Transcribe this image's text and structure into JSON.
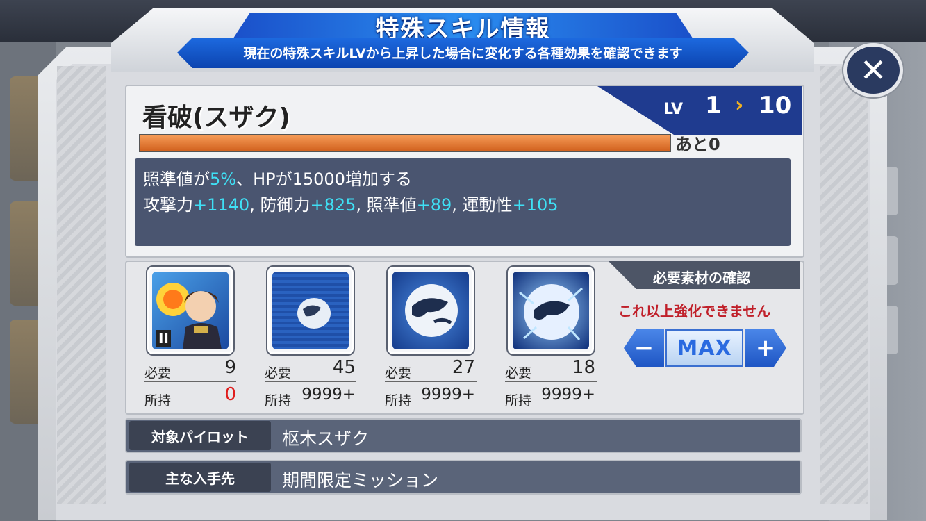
{
  "dialog": {
    "title": "特殊スキル情報",
    "subtitle": "現在の特殊スキルLVから上昇した場合に変化する各種効果を確認できます",
    "close_icon": "close-icon"
  },
  "skill": {
    "name": "看破(スザク)",
    "lv_label": "LV",
    "lv_current": "1",
    "lv_arrow": "›",
    "lv_target": "10",
    "progress_fraction": 1.0,
    "remaining": "あと0",
    "effect_line1": {
      "a": "照準値が",
      "b": "5%",
      "c": "、HPが15000増加する"
    },
    "effect_line2": {
      "s1": "攻撃力",
      "v1": "+1140",
      "s2": ", 防御力",
      "v2": "+825",
      "s3": ", 照準値",
      "v3": "+89",
      "s4": ", 運動性",
      "v4": "+105"
    }
  },
  "materials": {
    "required_label": "必要",
    "owned_label": "所持",
    "items": [
      {
        "icon": "pilot-portrait-icon",
        "badge": "II",
        "required": "9",
        "owned": "0"
      },
      {
        "icon": "small-orb-icon",
        "required": "45",
        "owned": "9999+"
      },
      {
        "icon": "medium-orb-icon",
        "required": "27",
        "owned": "9999+"
      },
      {
        "icon": "large-orb-icon",
        "required": "18",
        "owned": "9999+"
      }
    ],
    "check_title": "必要素材の確認",
    "limit_note": "これ以上強化できません",
    "minus_label": "−",
    "max_label": "MAX",
    "plus_label": "+"
  },
  "info": {
    "pilot_label": "対象パイロット",
    "pilot_value": "枢木スザク",
    "source_label": "主な入手先",
    "source_value": "期間限定ミッション"
  },
  "colors": {
    "accent_blue": "#1f56c4",
    "highlight_cyan": "#3fe0f5",
    "warning_red": "#c0202a",
    "bar_orange": "#d2621f"
  }
}
